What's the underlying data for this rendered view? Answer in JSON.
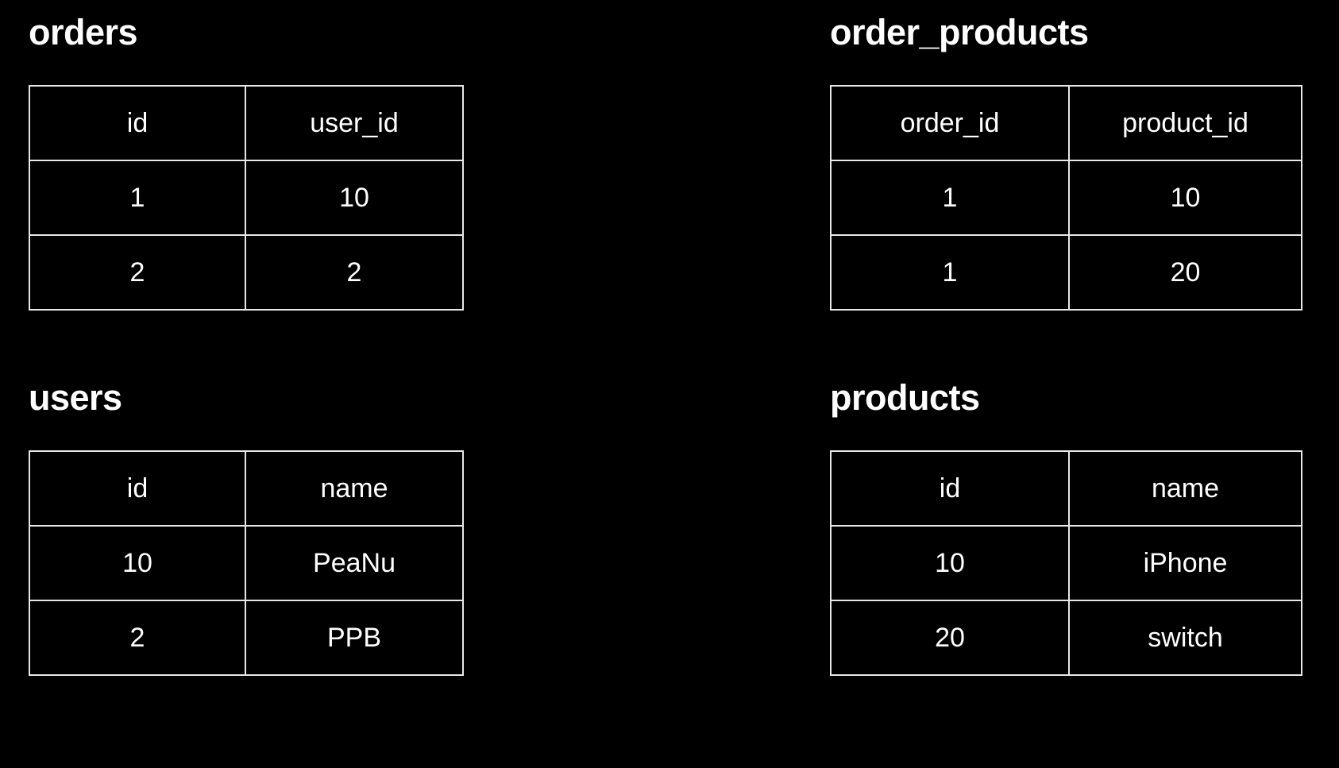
{
  "background_color": "#000000",
  "text_color": "#ffffff",
  "accent_colors": {
    "gold": "#ffc000",
    "green": "#00b050",
    "red": "#ff0000",
    "white": "#ffffff"
  },
  "tables": [
    {
      "id": "orders",
      "title": "orders",
      "columns": [
        "id",
        "user_id"
      ],
      "rows": [
        [
          {
            "text": "1",
            "color": "gold"
          },
          {
            "text": "10",
            "color": "green"
          }
        ],
        [
          {
            "text": "2",
            "color": "white"
          },
          {
            "text": "2",
            "color": "white"
          }
        ]
      ]
    },
    {
      "id": "order_products",
      "title": "order_products",
      "columns": [
        "order_id",
        "product_id"
      ],
      "rows": [
        [
          {
            "text": "1",
            "color": "gold"
          },
          {
            "text": "10",
            "color": "red"
          }
        ],
        [
          {
            "text": "1",
            "color": "gold"
          },
          {
            "text": "20",
            "color": "red"
          }
        ]
      ]
    },
    {
      "id": "users",
      "title": "users",
      "columns": [
        "id",
        "name"
      ],
      "rows": [
        [
          {
            "text": "10",
            "color": "green"
          },
          {
            "text": "PeaNu",
            "color": "green"
          }
        ],
        [
          {
            "text": "2",
            "color": "white"
          },
          {
            "text": "PPB",
            "color": "white"
          }
        ]
      ]
    },
    {
      "id": "products",
      "title": "products",
      "columns": [
        "id",
        "name"
      ],
      "rows": [
        [
          {
            "text": "10",
            "color": "red"
          },
          {
            "text": "iPhone",
            "color": "red"
          }
        ],
        [
          {
            "text": "20",
            "color": "red"
          },
          {
            "text": "switch",
            "color": "red"
          }
        ]
      ]
    }
  ]
}
